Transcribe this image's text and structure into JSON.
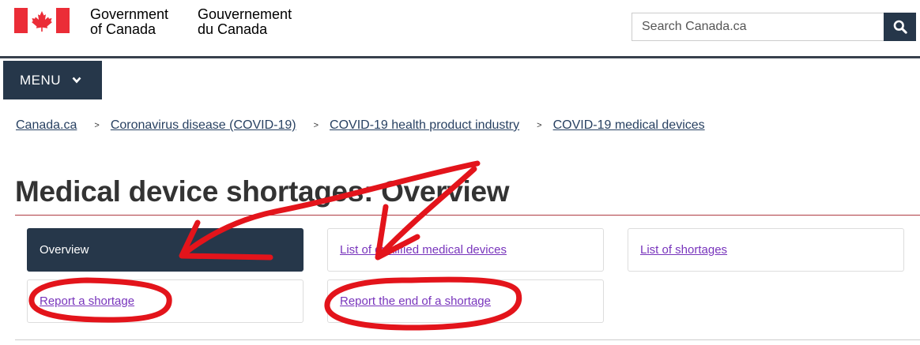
{
  "header": {
    "wordmark_en_line1": "Government",
    "wordmark_en_line2": "of Canada",
    "wordmark_fr_line1": "Gouvernement",
    "wordmark_fr_line2": "du Canada",
    "search_placeholder": "Search Canada.ca"
  },
  "menu": {
    "label": "MENU"
  },
  "breadcrumb": [
    "Canada.ca",
    "Coronavirus disease (COVID-19)",
    "COVID-19 health product industry",
    "COVID-19 medical devices"
  ],
  "breadcrumb_separator": ">",
  "page_title": "Medical device shortages: Overview",
  "nav_items": [
    "Overview",
    "List of qualified medical devices",
    "List of shortages",
    "Report a shortage",
    "Report the end of a shortage"
  ],
  "colors": {
    "navy": "#26374a",
    "link": "#284162",
    "visited_link": "#7834bc",
    "title_rule": "#af3c43",
    "annotation": "#e3141b"
  }
}
